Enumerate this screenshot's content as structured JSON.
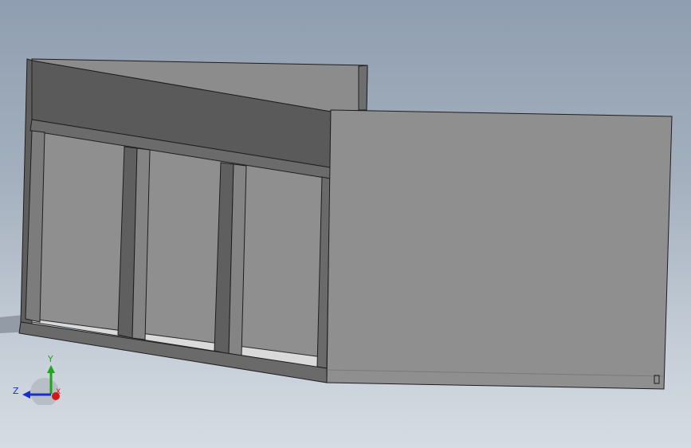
{
  "view": {
    "background_top": "#8f9eb0",
    "background_bottom": "#d6dce3"
  },
  "model": {
    "panel_light": "#8e8e8e",
    "panel_mid": "#7a7a7a",
    "panel_dark": "#5a5a5a",
    "edge": "#1e1e1e",
    "floor": "#dedede"
  },
  "triad": {
    "x_label": "X",
    "y_label": "Y",
    "z_label": "Z",
    "x_color": "#d41818",
    "y_color": "#18a818",
    "z_color": "#1830c8"
  }
}
